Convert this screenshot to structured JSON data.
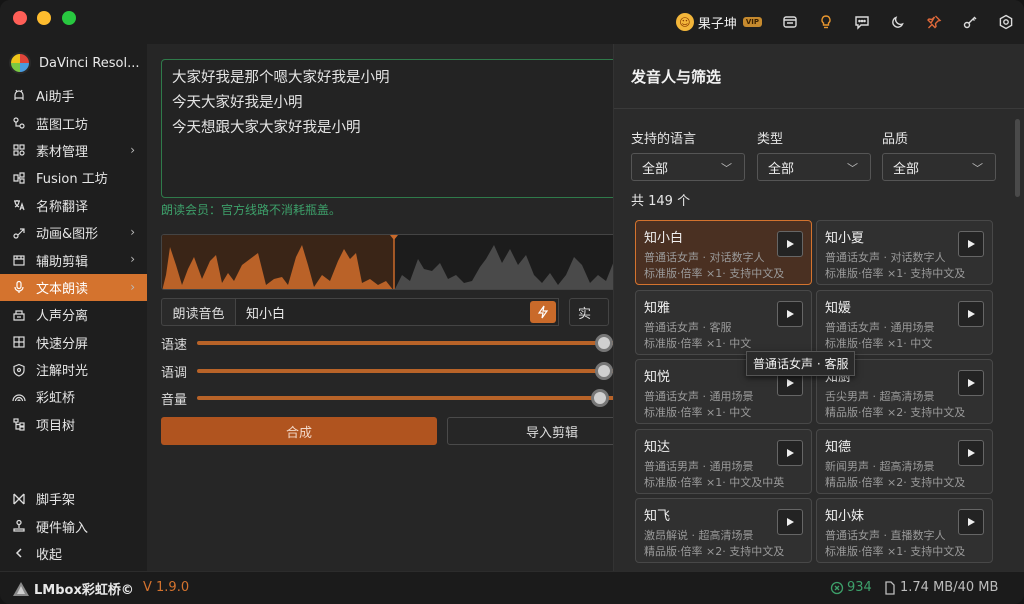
{
  "topbar": {
    "user_name": "果子坤",
    "vip_badge": "VIP",
    "icons": [
      "store-icon",
      "lightbulb-icon",
      "message-icon",
      "moon-icon",
      "pin-icon",
      "key-icon",
      "settings-icon"
    ]
  },
  "sidebar": {
    "app_name": "DaVinci Resol...",
    "items": [
      {
        "label": "Ai助手",
        "icon": "ai-icon",
        "chevron": false
      },
      {
        "label": "蓝图工坊",
        "icon": "blueprint-icon",
        "chevron": false
      },
      {
        "label": "素材管理",
        "icon": "assets-icon",
        "chevron": true
      },
      {
        "label": "Fusion 工坊",
        "icon": "fusion-icon",
        "chevron": false
      },
      {
        "label": "名称翻译",
        "icon": "translate-icon",
        "chevron": false
      },
      {
        "label": "动画&图形",
        "icon": "animation-icon",
        "chevron": true
      },
      {
        "label": "辅助剪辑",
        "icon": "edit-icon",
        "chevron": true
      },
      {
        "label": "文本朗读",
        "icon": "microphone-icon",
        "chevron": true,
        "active": true
      },
      {
        "label": "人声分离",
        "icon": "vocal-split-icon",
        "chevron": false
      },
      {
        "label": "快速分屏",
        "icon": "grid-icon",
        "chevron": false
      },
      {
        "label": "注解时光",
        "icon": "shield-icon",
        "chevron": false
      },
      {
        "label": "彩虹桥",
        "icon": "rainbow-icon",
        "chevron": false
      },
      {
        "label": "项目树",
        "icon": "tree-icon",
        "chevron": false
      }
    ],
    "bottom_items": [
      {
        "label": "脚手架",
        "icon": "scaffold-icon"
      },
      {
        "label": "硬件输入",
        "icon": "joystick-icon"
      },
      {
        "label": "收起",
        "icon": "chevron-left-icon"
      }
    ]
  },
  "main": {
    "text_lines": [
      "大家好我是那个嗯大家好我是小明",
      "今天大家好我是小明",
      "今天想跟大家大家好我是小明"
    ],
    "member_note": "朗读会员：官方线路不消耗瓶盖。",
    "voice_label": "朗读音色",
    "voice_value": "知小白",
    "right_button_label": "实",
    "sliders": [
      {
        "label": "语速",
        "value": 0.96
      },
      {
        "label": "语调",
        "value": 0.96
      },
      {
        "label": "音量",
        "value": 0.95
      }
    ],
    "synth_button": "合成",
    "import_button": "导入剪辑"
  },
  "panel": {
    "title": "发音人与筛选",
    "filters": [
      {
        "label": "支持的语言",
        "value": "全部"
      },
      {
        "label": "类型",
        "value": "全部"
      },
      {
        "label": "品质",
        "value": "全部"
      }
    ],
    "count": "共 149 个",
    "voices": [
      {
        "name": "知小白",
        "line1": "普通话女声 · 对话数字人",
        "line2": "标准版·倍率 ×1· 支持中文及...",
        "selected": true
      },
      {
        "name": "知小夏",
        "line1": "普通话女声 · 对话数字人",
        "line2": "标准版·倍率 ×1· 支持中文及..."
      },
      {
        "name": "知雅",
        "line1": "普通话女声 · 客服",
        "line2": "标准版·倍率 ×1· 中文"
      },
      {
        "name": "知媛",
        "line1": "普通话女声 · 通用场景",
        "line2": "标准版·倍率 ×1· 中文"
      },
      {
        "name": "知悦",
        "line1": "普通话女声 · 通用场景",
        "line2": "标准版·倍率 ×1· 中文"
      },
      {
        "name": "知厨",
        "line1": "舌尖男声 · 超高清场景",
        "line2": "精品版·倍率 ×2· 支持中文及..."
      },
      {
        "name": "知达",
        "line1": "普通话男声 · 通用场景",
        "line2": "标准版·倍率 ×1· 中文及中英..."
      },
      {
        "name": "知德",
        "line1": "新闻男声 · 超高清场景",
        "line2": "精品版·倍率 ×2· 支持中文及..."
      },
      {
        "name": "知飞",
        "line1": "激昂解说 · 超高清场景",
        "line2": "精品版·倍率 ×2· 支持中文及..."
      },
      {
        "name": "知小妹",
        "line1": "普通话女声 · 直播数字人",
        "line2": "标准版·倍率 ×1· 支持中文及..."
      }
    ],
    "tooltip": "普通话女声 · 客服"
  },
  "status": {
    "brand": "LMbox彩虹桥©",
    "version": "V 1.9.0",
    "points": "934",
    "size": "1.74 MB/40 MB"
  },
  "colors": {
    "accent": "#d4732e",
    "green": "#3da06a",
    "bg": "#1e1e1e"
  }
}
